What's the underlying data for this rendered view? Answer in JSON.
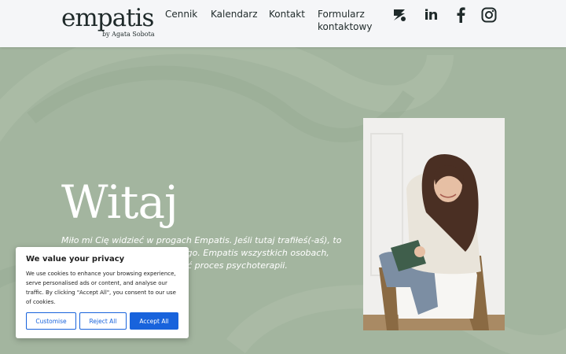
{
  "logo": {
    "name": "empatis",
    "tagline": "by Agata Sobota"
  },
  "nav": {
    "pricing": "Cennik",
    "calendar": "Kalendarz",
    "contact": "Kontakt",
    "contact_form_line1": "Formularz",
    "contact_form_line2": "kontaktowy"
  },
  "social": {
    "icons": [
      "znanylekarz-icon",
      "linkedin-icon",
      "facebook-icon",
      "instagram-icon"
    ],
    "linkedin_text": "in"
  },
  "hero": {
    "title": "Witaj",
    "intro": "Miło mi Cię widzieć w progach Empatis. Jeśli tutaj trafiłeś(-aś), to obszarze zdrowia psychicznego. Empatis wszystkich osobach, które potrzebują cą rozpocząć proces psychoterapii."
  },
  "cookie": {
    "title": "We value your privacy",
    "text": "We use cookies to enhance your browsing experience, serve personalised ads or content, and analyse our traffic. By clicking \"Accept All\", you consent to our use of cookies.",
    "customise": "Customise",
    "reject": "Reject All",
    "accept": "Accept All"
  },
  "colors": {
    "hero_bg": "#a3b59f",
    "header_bg": "#f5f6f8",
    "button_blue": "#1863dc",
    "text_dark": "#1f2a2a"
  }
}
